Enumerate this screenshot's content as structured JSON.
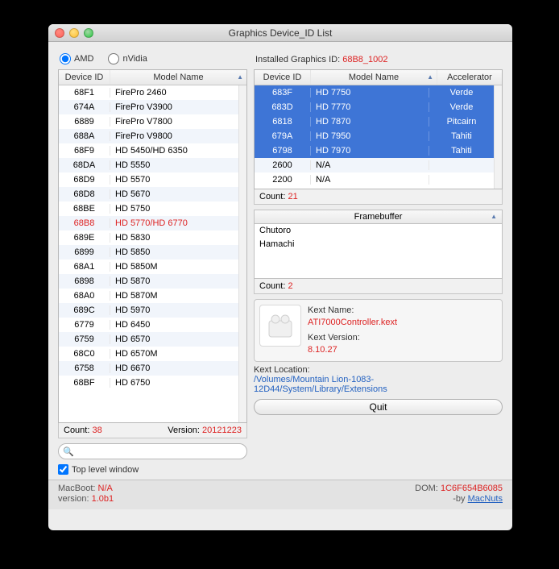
{
  "window": {
    "title": "Graphics Device_ID List"
  },
  "radios": {
    "amd": "AMD",
    "nvidia": "nVidia",
    "selected": "amd"
  },
  "installed": {
    "label": "Installed Graphics ID:",
    "value": "68B8_1002"
  },
  "left_table": {
    "headers": [
      "Device ID",
      "Model Name"
    ],
    "rows": [
      {
        "id": "68F1",
        "name": "FirePro 2460"
      },
      {
        "id": "674A",
        "name": "FirePro V3900"
      },
      {
        "id": "6889",
        "name": "FirePro V7800"
      },
      {
        "id": "688A",
        "name": "FirePro V9800"
      },
      {
        "id": "68F9",
        "name": "HD 5450/HD 6350"
      },
      {
        "id": "68DA",
        "name": "HD 5550"
      },
      {
        "id": "68D9",
        "name": "HD 5570"
      },
      {
        "id": "68D8",
        "name": "HD 5670"
      },
      {
        "id": "68BE",
        "name": "HD 5750"
      },
      {
        "id": "68B8",
        "name": "HD 5770/HD 6770",
        "highlight": true
      },
      {
        "id": "689E",
        "name": "HD 5830"
      },
      {
        "id": "6899",
        "name": "HD 5850"
      },
      {
        "id": "68A1",
        "name": "HD 5850M"
      },
      {
        "id": "6898",
        "name": "HD 5870"
      },
      {
        "id": "68A0",
        "name": "HD 5870M"
      },
      {
        "id": "689C",
        "name": "HD 5970"
      },
      {
        "id": "6779",
        "name": "HD 6450"
      },
      {
        "id": "6759",
        "name": "HD 6570"
      },
      {
        "id": "68C0",
        "name": "HD 6570M"
      },
      {
        "id": "6758",
        "name": "HD 6670"
      },
      {
        "id": "68BF",
        "name": "HD 6750"
      }
    ],
    "count_label": "Count:",
    "count": "38",
    "version_label": "Version:",
    "version": "20121223"
  },
  "right_table": {
    "headers": [
      "Device ID",
      "Model Name",
      "Accelerator"
    ],
    "rows": [
      {
        "id": "683F",
        "name": "HD 7750",
        "acc": "Verde",
        "sel": true
      },
      {
        "id": "683D",
        "name": "HD 7770",
        "acc": "Verde",
        "sel": true
      },
      {
        "id": "6818",
        "name": "HD 7870",
        "acc": "Pitcairn",
        "sel": true
      },
      {
        "id": "679A",
        "name": "HD 7950",
        "acc": "Tahiti",
        "sel": true
      },
      {
        "id": "6798",
        "name": "HD 7970",
        "acc": "Tahiti",
        "sel": true
      },
      {
        "id": "2600",
        "name": "N/A",
        "acc": ""
      },
      {
        "id": "2200",
        "name": "N/A",
        "acc": ""
      }
    ],
    "count_label": "Count:",
    "count": "21"
  },
  "framebuffer": {
    "header": "Framebuffer",
    "rows": [
      "Chutoro",
      "Hamachi"
    ],
    "count_label": "Count:",
    "count": "2"
  },
  "kext": {
    "name_label": "Kext Name:",
    "name": "ATI7000Controller.kext",
    "version_label": "Kext Version:",
    "version": "8.10.27",
    "location_label": "Kext Location:",
    "location": "/Volumes/Mountain Lion-1083-12D44/System/Library/Extensions"
  },
  "buttons": {
    "quit": "Quit"
  },
  "checkbox": {
    "top_level": "Top level window",
    "checked": true
  },
  "search": {
    "placeholder": ""
  },
  "footer": {
    "macboot_label": "MacBoot:",
    "macboot": "N/A",
    "version_label": "version:",
    "version": "1.0b1",
    "dom_label": "DOM:",
    "dom": "1C6F654B6085",
    "by_label": "-by",
    "author": "MacNuts"
  }
}
